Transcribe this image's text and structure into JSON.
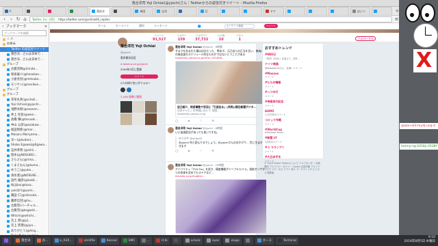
{
  "window": {
    "title": "落合洋司 Yoji Ochiai(@yjochi)さん｜Twitterからの返信付きツイート - Mozilla Firefox"
  },
  "tabs": [
    {
      "label": "P",
      "color": "#2b6cb0"
    },
    {
      "label": "",
      "color": "#555"
    },
    {
      "label": "",
      "color": "#e0245e"
    },
    {
      "label": "",
      "color": "#2b8a3e"
    },
    {
      "label": "落合洋",
      "color": "#1da1f2",
      "active": true
    },
    {
      "label": "",
      "color": "#4a4a4a"
    },
    {
      "label": "神田",
      "color": "#1da1f2"
    },
    {
      "label": "吉村",
      "color": "#1da1f2"
    },
    {
      "label": "",
      "color": "#2b6cb0"
    },
    {
      "label": "日",
      "color": "#1da1f2"
    },
    {
      "label": "",
      "color": "#1da1f2"
    },
    {
      "label": "",
      "color": "#1da1f2"
    },
    {
      "label": "ヤフ",
      "color": "#c0392b"
    },
    {
      "label": "",
      "color": "#1da1f2"
    },
    {
      "label": "",
      "color": "#1da1f2"
    },
    {
      "label": "",
      "color": "#1da1f2"
    },
    {
      "label": "ばいつ",
      "color": "#888"
    },
    {
      "label": "",
      "color": "#1da1f2"
    }
  ],
  "nav": {
    "url": "https://twitter.com/yjochi/with_replies",
    "secure_label": "Twitter, Inc. (US)"
  },
  "sidebar": {
    "title": "ブックマーク",
    "search_placeholder": "ブックマークを検索",
    "items": [
      {
        "label": "☆ 人",
        "type": "folder"
      },
      {
        "label": "お休み",
        "type": "folder"
      },
      {
        "label": "Twitter の返信付ツイート",
        "type": "link",
        "selected": true
      },
      {
        "label": "落合洋…さんは日本で…",
        "type": "link"
      },
      {
        "label": "落合洋…さんは日本で…",
        "type": "link"
      },
      {
        "label": "グループ",
        "type": "folder"
      },
      {
        "label": "古賀茂明@(hinite…",
        "type": "link"
      },
      {
        "label": "保坂展人(@hosakan…",
        "type": "link"
      },
      {
        "label": "小倉亮児(@mitsube…",
        "type": "link"
      },
      {
        "label": "モリケン(@moriken…",
        "type": "link"
      },
      {
        "label": "グループ",
        "type": "folder"
      },
      {
        "label": "グループ",
        "type": "folder"
      },
      {
        "label": "茶茶丸茶(@scholi…",
        "type": "link"
      },
      {
        "label": "Yoji Ochiai(@yjochi…",
        "type": "link"
      },
      {
        "label": "浅野太郎(@asanon…",
        "type": "link"
      },
      {
        "label": "井上 社長(@wan…",
        "type": "link"
      },
      {
        "label": "高橋 輝(@teruaki…",
        "type": "link"
      },
      {
        "label": "中山 公彦(@ozakaw…",
        "type": "link"
      },
      {
        "label": "松田明彦(@mar…",
        "type": "link"
      },
      {
        "label": "Masaru Moriyama…",
        "type": "link"
      },
      {
        "label": "洋一(@kudan)…",
        "type": "link"
      },
      {
        "label": "Shoko Egawa(@Egawa…",
        "type": "link"
      },
      {
        "label": "石井孝明 (@ishii…",
        "type": "link"
      },
      {
        "label": "悠木(@NOSUKE)…",
        "type": "link"
      },
      {
        "label": "さらさん(@rima…",
        "type": "link"
      },
      {
        "label": "くまえもん(@kuma…",
        "type": "link"
      },
      {
        "label": "ゆうこ(@yuko…",
        "type": "link"
      },
      {
        "label": "清水潔(@NOSUKE…",
        "type": "link"
      },
      {
        "label": "田代 雅彦(@kakit…",
        "type": "link"
      },
      {
        "label": "Nijijiko(@taxa…",
        "type": "link"
      },
      {
        "label": "yukiお!(@yumi…",
        "type": "link"
      },
      {
        "label": "篠田 仁(@shinoda…",
        "type": "link"
      },
      {
        "label": "藤原信世(@hu…",
        "type": "link"
      },
      {
        "label": "古賀茂(バーチャル…",
        "type": "link"
      },
      {
        "label": "古賀茂(@kogashi…",
        "type": "link"
      },
      {
        "label": "Which(@whichi…",
        "type": "link"
      },
      {
        "label": "次上 眞(@jiji…",
        "type": "link"
      },
      {
        "label": "次上 眞理(@jiyo…",
        "type": "link"
      },
      {
        "label": "ありがとう(@Arig…",
        "type": "link"
      },
      {
        "label": "Dukeきよし(@doke…",
        "type": "link"
      },
      {
        "label": "グループ",
        "type": "folder"
      }
    ]
  },
  "twitter": {
    "nav": {
      "home": "ホーム",
      "moments": "モーメント",
      "notifications": "通知",
      "messages": "メッセージ",
      "search": "キーワード検索",
      "tweet_button": "ツイート"
    },
    "profile": {
      "name": "落合洋司 Yoji Ochiai",
      "handle": "@yjochi",
      "stats": [
        {
          "label": "ツイート",
          "value": "91,517"
        },
        {
          "label": "フォロー",
          "value": "159"
        },
        {
          "label": "フォロワー",
          "value": "37,732"
        },
        {
          "label": "いいね",
          "value": "10"
        },
        {
          "label": "リスト",
          "value": "1"
        }
      ],
      "follow_label": "フォローする",
      "location": "東京都渋谷区",
      "website": "d.hatena.ne.jp/yjochi",
      "joined": "2009年5月に登録",
      "tweet_to": "ツイート",
      "mutual_label": "2人の知り合いがフォロー",
      "media_label": "3,446 画像と動画"
    },
    "tweets": [
      {
        "name": "落合洋司 Yoji Ochiai",
        "handle": "@yjochi · 6時間",
        "text": "ずるさを含まれた優は自分だった、熊本ボ、元乃自らの正当を言い、無為に、の検出部のスケジュール的なものかではないとうことがある",
        "link": "headlines.yahoo.co.jp/hl?a=201808...",
        "card_title": "自己紹介、校長尊敬で状況に「引退出る」(共同)(朝日新聞デジタ...",
        "card_desc": "日本テレビ」の中国において 米国...",
        "card_source": "headlines.yahoo.co.jp",
        "replies": "",
        "retweets": "",
        "likes": ""
      },
      {
        "name": "落合洋司 Yoji Ochiai",
        "handle": "@yjochi · 6時間",
        "text": "いい加減変化があっても良いですね。",
        "reply_to": "ゆうきや @shita43",
        "reply_text": "@yjochi 何と読んでるでしょう。@yjochiさんのおかげで... 世に生まれてきます",
        "replies": "",
        "retweets": "",
        "likes": ""
      },
      {
        "name": "落合洋司 Yoji Ochiai",
        "handle": "@yjochi · 10時間",
        "text": "アイバリティ「P20 Pro」を試す、精度機能がトリプルカメラ。指紋センサからの気体を含めてもステキなど...",
        "link": "itmedia.co.jp/mobile/...",
        "replies": "",
        "retweets": "",
        "likes": ""
      }
    ],
    "trends": {
      "title": "おすすめトレンド",
      "items": [
        {
          "tag": "#NEE日",
          "desc": "「米刊（今月）」を迎えて、日本..."
        },
        {
          "tag": "ドイツ映画",
          "desc": "@Mabeberlinさん・北海...ツイート"
        },
        {
          "tag": "#Masaos",
          "desc": "ツイート"
        },
        {
          "tag": "#たちの情報",
          "desc": "ツイート"
        },
        {
          "tag": "#ハフの行",
          "desc": "ツイート"
        },
        {
          "tag": "#神尾幸の記念",
          "desc": "ツイート"
        },
        {
          "tag": "ASMO",
          "desc": "1.25万件のツイート"
        },
        {
          "tag": "コミック作戦",
          "desc": "ツイート"
        },
        {
          "tag": "#WorldCup",
          "desc": "#Hashbat #mar..."
        },
        {
          "tag": "#新聞 LF",
          "desc": "1万件のツイート"
        },
        {
          "tag": "#ユ ラランプリ",
          "desc": "ツイート"
        },
        {
          "tag": "#大日本平木",
          "desc": "ツイート"
        }
      ]
    },
    "footer": "© 2018 Twitter  Twitterについて  ヘルプセンター  利用規約  プライバシーポリシー  Cookie  広告情報  ブランド  ブログ  ステータス  アプリ  求人  マーケティング  ビジネス  開発者"
  },
  "desktop": {
    "widget1": "@wan-aiit-mydj-unq-d",
    "widget2": "harmy-ng-2018y-2018Y"
  },
  "taskbar": {
    "items": [
      "",
      "落合洋",
      "谷…",
      "e_X20…",
      "simifile",
      "Kensol",
      "SMC",
      "...",
      "rt.lk",
      "",
      "xclock",
      "eyes",
      "xlogo",
      "",
      "ホース",
      "Terminal"
    ],
    "time": "9:10",
    "date": "2018年8月5日 水曜日"
  }
}
